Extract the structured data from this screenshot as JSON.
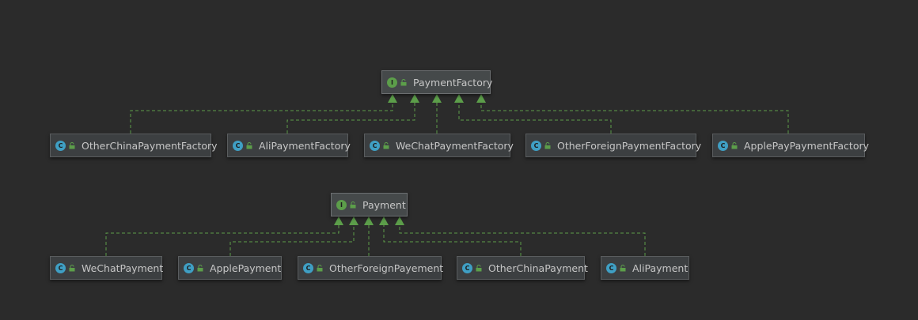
{
  "colors": {
    "background": "#2b2b2b",
    "node_fill": "#3c3f41",
    "node_border": "#5a5d5f",
    "text": "#c6c6c6",
    "class_badge": "#3f9fc4",
    "interface_badge": "#5c9e4a",
    "edge": "#5c9e4a"
  },
  "relationship": "implements",
  "groups": [
    {
      "interface": {
        "name": "PaymentFactory",
        "badge": "I",
        "icon": "interface-icon"
      },
      "classes": [
        {
          "name": "OtherChinaPaymentFactory",
          "badge": "C",
          "icon": "class-icon"
        },
        {
          "name": "AliPaymentFactory",
          "badge": "C",
          "icon": "class-icon"
        },
        {
          "name": "WeChatPaymentFactory",
          "badge": "C",
          "icon": "class-icon"
        },
        {
          "name": "OtherForeignPaymentFactory",
          "badge": "C",
          "icon": "class-icon"
        },
        {
          "name": "ApplePayPaymentFactory",
          "badge": "C",
          "icon": "class-icon"
        }
      ]
    },
    {
      "interface": {
        "name": "Payment",
        "badge": "I",
        "icon": "interface-icon"
      },
      "classes": [
        {
          "name": "WeChatPayment",
          "badge": "C",
          "icon": "class-icon"
        },
        {
          "name": "ApplePayment",
          "badge": "C",
          "icon": "class-icon"
        },
        {
          "name": "OtherForeignPayement",
          "badge": "C",
          "icon": "class-icon"
        },
        {
          "name": "OtherChinaPayment",
          "badge": "C",
          "icon": "class-icon"
        },
        {
          "name": "AliPayment",
          "badge": "C",
          "icon": "class-icon"
        }
      ]
    }
  ]
}
